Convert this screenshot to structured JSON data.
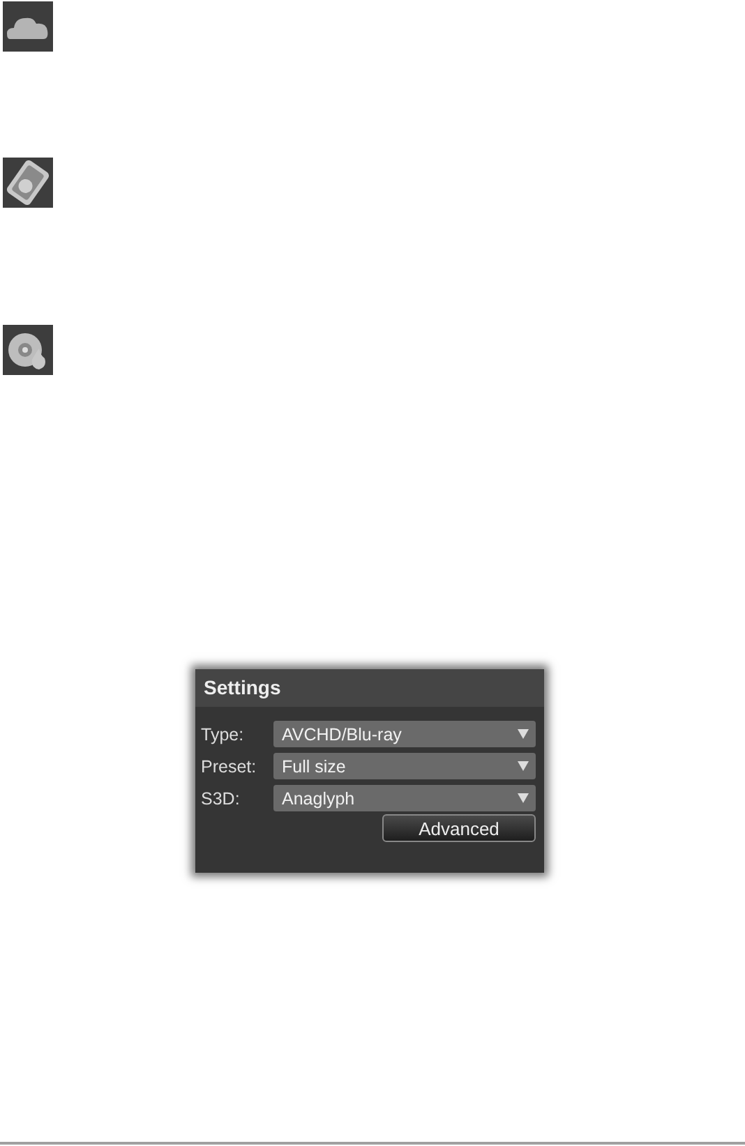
{
  "settings": {
    "title": "Settings",
    "fields": [
      {
        "label": "Type:",
        "value": "AVCHD/Blu-ray"
      },
      {
        "label": "Preset:",
        "value": "Full size"
      },
      {
        "label": "S3D:",
        "value": "Anaglyph"
      }
    ],
    "button": "Advanced"
  }
}
